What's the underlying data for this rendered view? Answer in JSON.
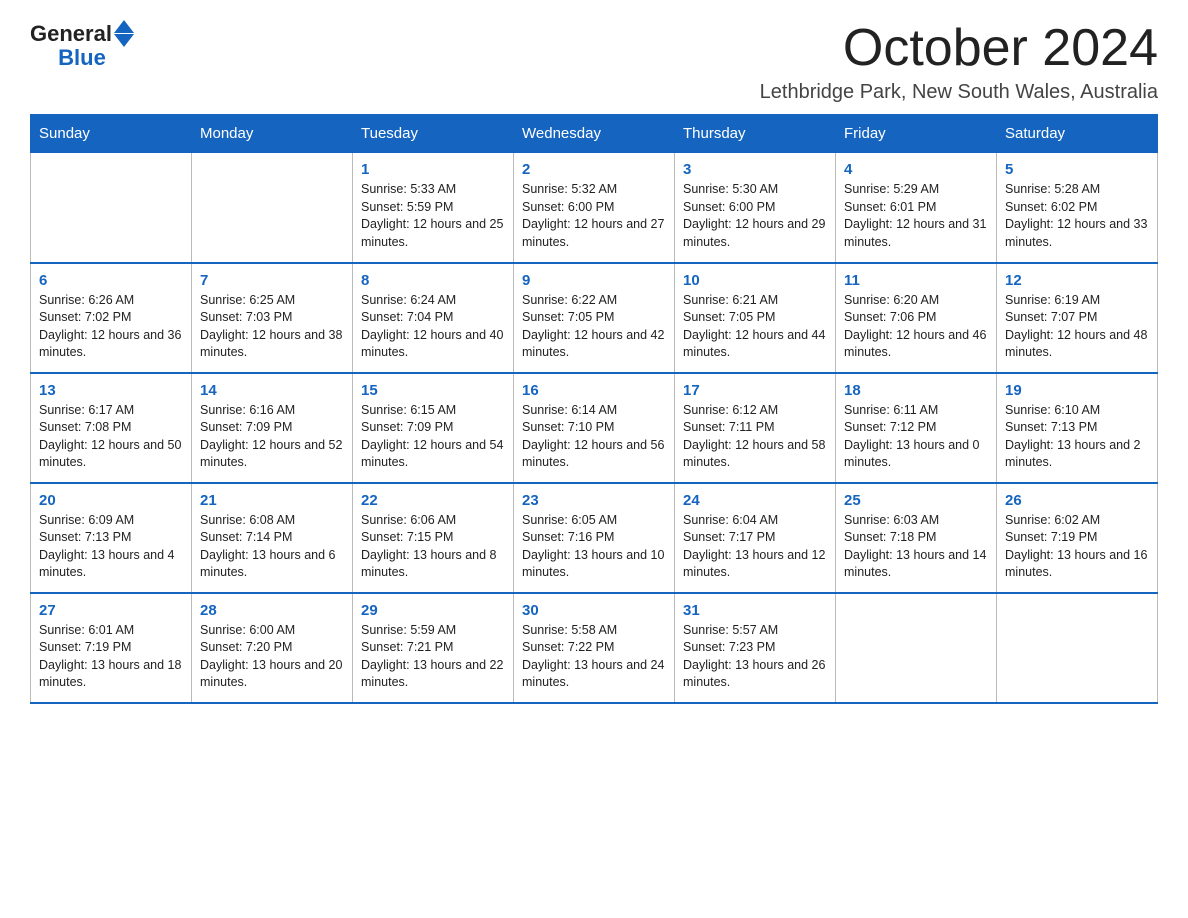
{
  "logo": {
    "general": "General",
    "blue": "Blue"
  },
  "header": {
    "month": "October 2024",
    "location": "Lethbridge Park, New South Wales, Australia"
  },
  "days_of_week": [
    "Sunday",
    "Monday",
    "Tuesday",
    "Wednesday",
    "Thursday",
    "Friday",
    "Saturday"
  ],
  "weeks": [
    [
      {
        "day": "",
        "sunrise": "",
        "sunset": "",
        "daylight": ""
      },
      {
        "day": "",
        "sunrise": "",
        "sunset": "",
        "daylight": ""
      },
      {
        "day": "1",
        "sunrise": "Sunrise: 5:33 AM",
        "sunset": "Sunset: 5:59 PM",
        "daylight": "Daylight: 12 hours and 25 minutes."
      },
      {
        "day": "2",
        "sunrise": "Sunrise: 5:32 AM",
        "sunset": "Sunset: 6:00 PM",
        "daylight": "Daylight: 12 hours and 27 minutes."
      },
      {
        "day": "3",
        "sunrise": "Sunrise: 5:30 AM",
        "sunset": "Sunset: 6:00 PM",
        "daylight": "Daylight: 12 hours and 29 minutes."
      },
      {
        "day": "4",
        "sunrise": "Sunrise: 5:29 AM",
        "sunset": "Sunset: 6:01 PM",
        "daylight": "Daylight: 12 hours and 31 minutes."
      },
      {
        "day": "5",
        "sunrise": "Sunrise: 5:28 AM",
        "sunset": "Sunset: 6:02 PM",
        "daylight": "Daylight: 12 hours and 33 minutes."
      }
    ],
    [
      {
        "day": "6",
        "sunrise": "Sunrise: 6:26 AM",
        "sunset": "Sunset: 7:02 PM",
        "daylight": "Daylight: 12 hours and 36 minutes."
      },
      {
        "day": "7",
        "sunrise": "Sunrise: 6:25 AM",
        "sunset": "Sunset: 7:03 PM",
        "daylight": "Daylight: 12 hours and 38 minutes."
      },
      {
        "day": "8",
        "sunrise": "Sunrise: 6:24 AM",
        "sunset": "Sunset: 7:04 PM",
        "daylight": "Daylight: 12 hours and 40 minutes."
      },
      {
        "day": "9",
        "sunrise": "Sunrise: 6:22 AM",
        "sunset": "Sunset: 7:05 PM",
        "daylight": "Daylight: 12 hours and 42 minutes."
      },
      {
        "day": "10",
        "sunrise": "Sunrise: 6:21 AM",
        "sunset": "Sunset: 7:05 PM",
        "daylight": "Daylight: 12 hours and 44 minutes."
      },
      {
        "day": "11",
        "sunrise": "Sunrise: 6:20 AM",
        "sunset": "Sunset: 7:06 PM",
        "daylight": "Daylight: 12 hours and 46 minutes."
      },
      {
        "day": "12",
        "sunrise": "Sunrise: 6:19 AM",
        "sunset": "Sunset: 7:07 PM",
        "daylight": "Daylight: 12 hours and 48 minutes."
      }
    ],
    [
      {
        "day": "13",
        "sunrise": "Sunrise: 6:17 AM",
        "sunset": "Sunset: 7:08 PM",
        "daylight": "Daylight: 12 hours and 50 minutes."
      },
      {
        "day": "14",
        "sunrise": "Sunrise: 6:16 AM",
        "sunset": "Sunset: 7:09 PM",
        "daylight": "Daylight: 12 hours and 52 minutes."
      },
      {
        "day": "15",
        "sunrise": "Sunrise: 6:15 AM",
        "sunset": "Sunset: 7:09 PM",
        "daylight": "Daylight: 12 hours and 54 minutes."
      },
      {
        "day": "16",
        "sunrise": "Sunrise: 6:14 AM",
        "sunset": "Sunset: 7:10 PM",
        "daylight": "Daylight: 12 hours and 56 minutes."
      },
      {
        "day": "17",
        "sunrise": "Sunrise: 6:12 AM",
        "sunset": "Sunset: 7:11 PM",
        "daylight": "Daylight: 12 hours and 58 minutes."
      },
      {
        "day": "18",
        "sunrise": "Sunrise: 6:11 AM",
        "sunset": "Sunset: 7:12 PM",
        "daylight": "Daylight: 13 hours and 0 minutes."
      },
      {
        "day": "19",
        "sunrise": "Sunrise: 6:10 AM",
        "sunset": "Sunset: 7:13 PM",
        "daylight": "Daylight: 13 hours and 2 minutes."
      }
    ],
    [
      {
        "day": "20",
        "sunrise": "Sunrise: 6:09 AM",
        "sunset": "Sunset: 7:13 PM",
        "daylight": "Daylight: 13 hours and 4 minutes."
      },
      {
        "day": "21",
        "sunrise": "Sunrise: 6:08 AM",
        "sunset": "Sunset: 7:14 PM",
        "daylight": "Daylight: 13 hours and 6 minutes."
      },
      {
        "day": "22",
        "sunrise": "Sunrise: 6:06 AM",
        "sunset": "Sunset: 7:15 PM",
        "daylight": "Daylight: 13 hours and 8 minutes."
      },
      {
        "day": "23",
        "sunrise": "Sunrise: 6:05 AM",
        "sunset": "Sunset: 7:16 PM",
        "daylight": "Daylight: 13 hours and 10 minutes."
      },
      {
        "day": "24",
        "sunrise": "Sunrise: 6:04 AM",
        "sunset": "Sunset: 7:17 PM",
        "daylight": "Daylight: 13 hours and 12 minutes."
      },
      {
        "day": "25",
        "sunrise": "Sunrise: 6:03 AM",
        "sunset": "Sunset: 7:18 PM",
        "daylight": "Daylight: 13 hours and 14 minutes."
      },
      {
        "day": "26",
        "sunrise": "Sunrise: 6:02 AM",
        "sunset": "Sunset: 7:19 PM",
        "daylight": "Daylight: 13 hours and 16 minutes."
      }
    ],
    [
      {
        "day": "27",
        "sunrise": "Sunrise: 6:01 AM",
        "sunset": "Sunset: 7:19 PM",
        "daylight": "Daylight: 13 hours and 18 minutes."
      },
      {
        "day": "28",
        "sunrise": "Sunrise: 6:00 AM",
        "sunset": "Sunset: 7:20 PM",
        "daylight": "Daylight: 13 hours and 20 minutes."
      },
      {
        "day": "29",
        "sunrise": "Sunrise: 5:59 AM",
        "sunset": "Sunset: 7:21 PM",
        "daylight": "Daylight: 13 hours and 22 minutes."
      },
      {
        "day": "30",
        "sunrise": "Sunrise: 5:58 AM",
        "sunset": "Sunset: 7:22 PM",
        "daylight": "Daylight: 13 hours and 24 minutes."
      },
      {
        "day": "31",
        "sunrise": "Sunrise: 5:57 AM",
        "sunset": "Sunset: 7:23 PM",
        "daylight": "Daylight: 13 hours and 26 minutes."
      },
      {
        "day": "",
        "sunrise": "",
        "sunset": "",
        "daylight": ""
      },
      {
        "day": "",
        "sunrise": "",
        "sunset": "",
        "daylight": ""
      }
    ]
  ]
}
